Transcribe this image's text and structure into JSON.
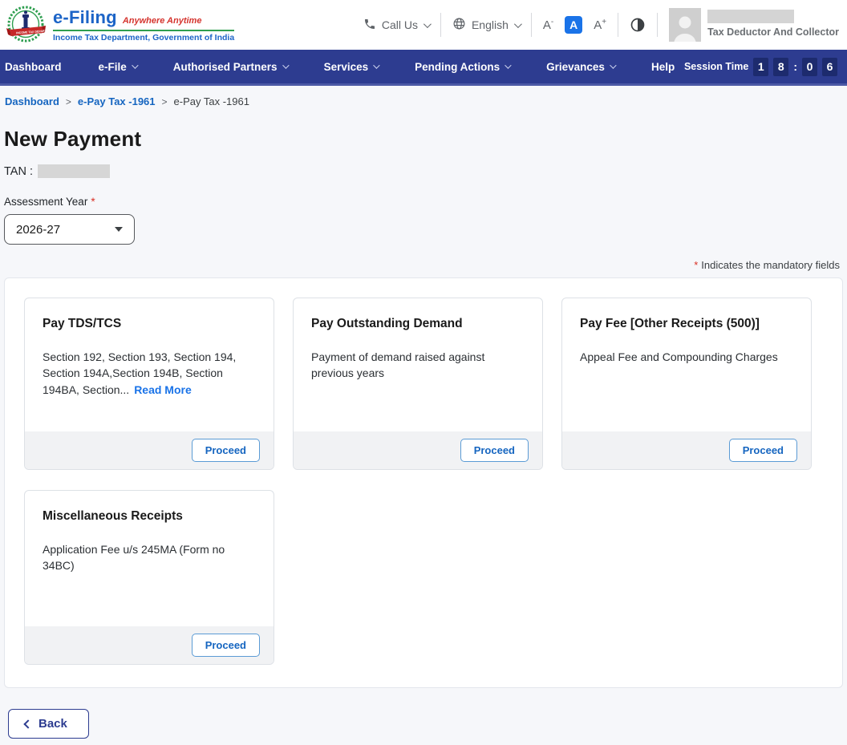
{
  "header": {
    "brand": {
      "title": "e-Filing",
      "tagline": "Anywhere Anytime",
      "subtitle": "Income Tax Department, Government of India"
    },
    "call_us_label": "Call Us",
    "language_label": "English",
    "font_controls": {
      "decrease": "A",
      "decrease_sup": "-",
      "normal": "A",
      "increase": "A",
      "increase_sup": "+"
    },
    "user": {
      "role": "Tax Deductor And Collector"
    }
  },
  "nav": {
    "items": [
      {
        "label": "Dashboard"
      },
      {
        "label": "e-File"
      },
      {
        "label": "Authorised Partners"
      },
      {
        "label": "Services"
      },
      {
        "label": "Pending Actions"
      },
      {
        "label": "Grievances"
      },
      {
        "label": "Help"
      }
    ],
    "session": {
      "label": "Session Time",
      "digits": [
        "1",
        "8",
        "0",
        "6"
      ],
      "separator": ":"
    }
  },
  "breadcrumb": {
    "items": [
      {
        "label": "Dashboard"
      },
      {
        "label": "e-Pay Tax -1961"
      },
      {
        "label": "e-Pay Tax -1961"
      }
    ],
    "separator": ">"
  },
  "main": {
    "title": "New Payment",
    "tan_label": "TAN :",
    "assessment_year": {
      "label": "Assessment Year",
      "required_mark": "*",
      "value": "2026-27"
    },
    "mandatory_note": {
      "star": "*",
      "text": "Indicates the mandatory fields"
    },
    "cards": [
      {
        "title": "Pay TDS/TCS",
        "description": "Section 192, Section 193, Section 194, Section 194A,Section 194B, Section 194BA, Section...",
        "read_more": "Read More",
        "action": "Proceed"
      },
      {
        "title": "Pay Outstanding Demand",
        "description": "Payment of demand raised against previous years",
        "action": "Proceed"
      },
      {
        "title": "Pay Fee [Other Receipts (500)]",
        "description": "Appeal Fee and Compounding Charges",
        "action": "Proceed"
      },
      {
        "title": "Miscellaneous Receipts",
        "description": "Application Fee u/s 245MA (Form no 34BC)",
        "action": "Proceed"
      }
    ],
    "back_label": "Back"
  },
  "colors": {
    "nav_navy": "#2d3c90",
    "session_box": "#1d2b6e",
    "link_blue": "#1565c0",
    "accent_blue": "#1a73e8",
    "brand_blue": "#1c64c7",
    "brand_red": "#d5342e",
    "brand_green": "#2e9e4f",
    "required_red": "#d93025",
    "page_bg": "#f6f7fa"
  }
}
